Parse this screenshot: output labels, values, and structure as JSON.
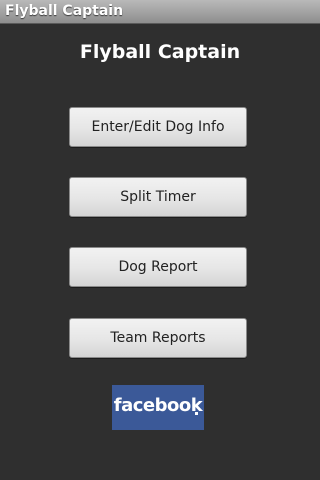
{
  "title_bar": {
    "title": "Flyball Captain"
  },
  "main": {
    "heading": "Flyball Captain",
    "buttons": [
      {
        "label": "Enter/Edit Dog Info"
      },
      {
        "label": "Split Timer"
      },
      {
        "label": "Dog Report"
      },
      {
        "label": "Team Reports"
      }
    ],
    "facebook": {
      "logo_text": "facebook",
      "icon": "facebook-logo",
      "color": "#3b5998"
    }
  },
  "colors": {
    "background": "#2f2f2f",
    "title_bar": "#a4a4a4",
    "button_face": "#e6e6e6",
    "button_text": "#222222"
  }
}
